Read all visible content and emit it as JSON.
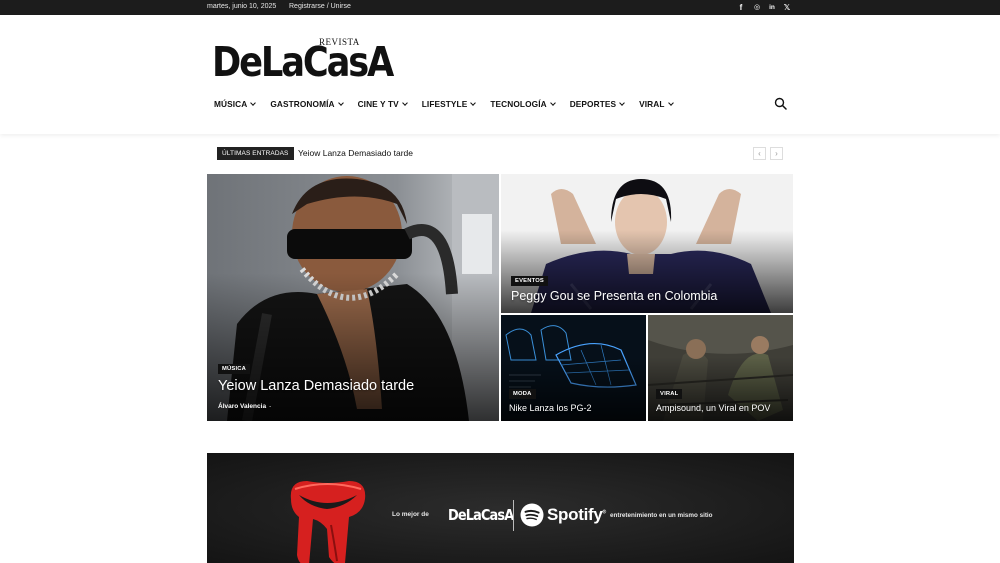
{
  "topbar": {
    "date": "martes, junio 10, 2025",
    "login": "Registrarse / Unirse",
    "social": [
      {
        "icon": "facebook-icon",
        "glyph": "f"
      },
      {
        "icon": "instagram-icon",
        "glyph": "◎"
      },
      {
        "icon": "linkedin-icon",
        "glyph": "in"
      },
      {
        "icon": "x-icon",
        "glyph": "𝕏"
      }
    ]
  },
  "logo": {
    "small": "REVISTA",
    "word": "DeLaCasA"
  },
  "nav": {
    "items": [
      "MÚSICA",
      "GASTRONOMÍA",
      "CINE Y TV",
      "LIFESTYLE",
      "TECNOLOGÍA",
      "DEPORTES",
      "VIRAL"
    ]
  },
  "ticker": {
    "label": "ÚLTIMAS ENTRADAS",
    "text": "Yeiow Lanza Demasiado tarde",
    "prev": "‹",
    "next": "›"
  },
  "featured": {
    "main": {
      "category": "MÚSICA",
      "title": "Yeiow Lanza Demasiado tarde",
      "author": "Álvaro Valencia",
      "dash": "-"
    },
    "top_right": {
      "category": "EVENTOS",
      "title": "Peggy Gou se Presenta en Colombia"
    },
    "bottom_left": {
      "category": "MODA",
      "title": "Nike Lanza los PG-2"
    },
    "bottom_right": {
      "category": "VIRAL",
      "title": "Ampisound, un Viral en POV"
    }
  },
  "banner": {
    "pre": "Lo mejor de",
    "logo": "DeLaCasA",
    "brand": "Spotify",
    "trademark": "®",
    "post": "entretenimiento en un mismo sitio"
  },
  "colors": {
    "topbar": "#1c1c1c",
    "spotify_green": "#1ed760",
    "tongue_red": "#d6201f"
  }
}
